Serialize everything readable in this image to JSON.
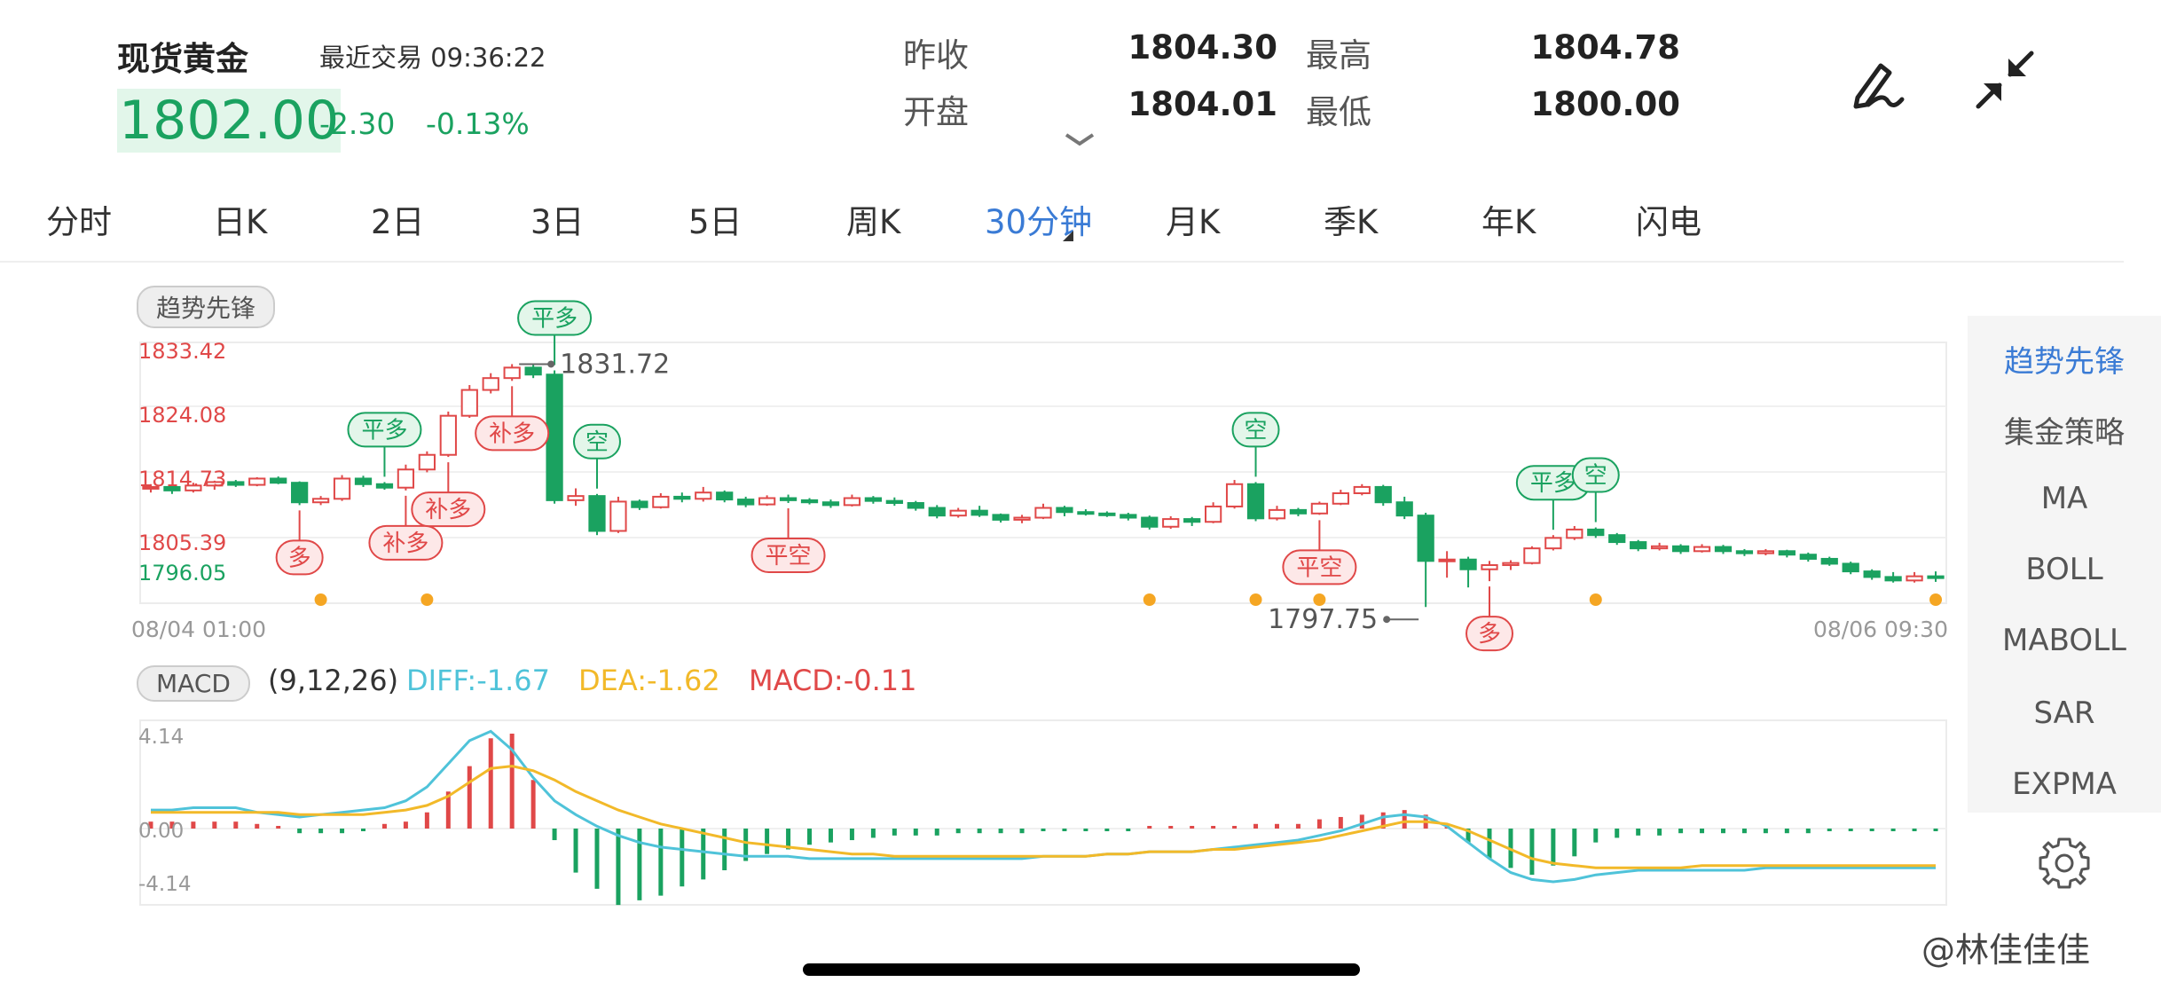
{
  "header": {
    "title": "现货黄金",
    "last_trade_label": "最近交易",
    "last_trade_time": "09:36:22",
    "price": "1802.00",
    "change": "-2.30",
    "change_pct": "-0.13%",
    "up_color": "#e04848",
    "down_color": "#1aa260"
  },
  "quote": {
    "prev_close_label": "昨收",
    "prev_close": "1804.30",
    "open_label": "开盘",
    "open": "1804.01",
    "high_label": "最高",
    "high": "1804.78",
    "low_label": "最低",
    "low": "1800.00"
  },
  "icons": {
    "collapse": "chevron-down-icon",
    "edit": "pen-icon",
    "shrink": "shrink-arrows-icon",
    "settings": "gear-icon"
  },
  "tabs": [
    {
      "label": "分时"
    },
    {
      "label": "日K"
    },
    {
      "label": "2日"
    },
    {
      "label": "3日"
    },
    {
      "label": "5日"
    },
    {
      "label": "周K"
    },
    {
      "label": "30分钟",
      "active": true
    },
    {
      "label": "月K"
    },
    {
      "label": "季K"
    },
    {
      "label": "年K"
    },
    {
      "label": "闪电"
    }
  ],
  "side_indicators": [
    {
      "label": "趋势先锋",
      "active": true
    },
    {
      "label": "集金策略"
    },
    {
      "label": "MA"
    },
    {
      "label": "BOLL"
    },
    {
      "label": "MABOLL"
    },
    {
      "label": "SAR"
    },
    {
      "label": "EXPMA"
    }
  ],
  "main_indicator": "趋势先锋",
  "sub_indicator": {
    "name": "MACD",
    "params": "(9,12,26)",
    "diff": "DIFF:-1.67",
    "dea": "DEA:-1.62",
    "macd": "MACD:-0.11",
    "diff_color": "#4fc3d9",
    "dea_color": "#f2b929",
    "macd_color": "#e04848"
  },
  "watermark": "@林佳佳佳",
  "chart_data": [
    {
      "type": "candlestick",
      "title": "",
      "y_ticks": [
        "1833.42",
        "1824.08",
        "1814.73",
        "1805.39",
        "1796.05"
      ],
      "x_ticks": [
        "08/04 01:00",
        "08/06 09:30"
      ],
      "ylim": [
        1796.05,
        1833.42
      ],
      "grid": true,
      "annotations": {
        "max_label": "1831.72",
        "min_label": "1797.75"
      },
      "signals": [
        {
          "index": 7,
          "label": "多",
          "kind": "buy"
        },
        {
          "index": 11,
          "label": "平多",
          "kind": "close"
        },
        {
          "index": 12,
          "label": "补多",
          "kind": "buy"
        },
        {
          "index": 14,
          "label": "补多",
          "kind": "buy"
        },
        {
          "index": 17,
          "label": "补多",
          "kind": "buy"
        },
        {
          "index": 19,
          "label": "平多",
          "kind": "close"
        },
        {
          "index": 21,
          "label": "空",
          "kind": "sell"
        },
        {
          "index": 30,
          "label": "平空",
          "kind": "close"
        },
        {
          "index": 52,
          "label": "空",
          "kind": "sell"
        },
        {
          "index": 55,
          "label": "平空",
          "kind": "close"
        },
        {
          "index": 63,
          "label": "多",
          "kind": "buy"
        },
        {
          "index": 66,
          "label": "平多",
          "kind": "close"
        },
        {
          "index": 68,
          "label": "空",
          "kind": "sell"
        }
      ],
      "dot_indices": [
        8,
        13,
        47,
        52,
        55,
        68,
        84,
        89
      ],
      "candles": [
        [
          1814.8,
          1815.4,
          1814.2,
          1815.0
        ],
        [
          1815.0,
          1815.2,
          1814.0,
          1814.5
        ],
        [
          1814.5,
          1815.6,
          1814.2,
          1815.2
        ],
        [
          1815.2,
          1815.9,
          1814.6,
          1815.7
        ],
        [
          1815.7,
          1816.0,
          1815.0,
          1815.3
        ],
        [
          1815.3,
          1816.4,
          1815.1,
          1816.2
        ],
        [
          1816.2,
          1816.5,
          1815.4,
          1815.6
        ],
        [
          1815.6,
          1815.8,
          1812.4,
          1812.8
        ],
        [
          1812.8,
          1813.7,
          1812.4,
          1813.3
        ],
        [
          1813.3,
          1816.7,
          1813.0,
          1816.2
        ],
        [
          1816.2,
          1816.6,
          1815.0,
          1815.4
        ],
        [
          1815.4,
          1815.7,
          1814.6,
          1814.9
        ],
        [
          1814.9,
          1818.2,
          1814.5,
          1817.5
        ],
        [
          1817.5,
          1820.1,
          1817.1,
          1819.6
        ],
        [
          1819.6,
          1825.8,
          1819.3,
          1825.2
        ],
        [
          1825.2,
          1829.6,
          1824.9,
          1828.9
        ],
        [
          1828.9,
          1831.3,
          1828.4,
          1830.6
        ],
        [
          1830.6,
          1832.6,
          1830.2,
          1832.1
        ],
        [
          1832.1,
          1832.5,
          1830.6,
          1831.1
        ],
        [
          1831.1,
          1831.7,
          1812.6,
          1813.1
        ],
        [
          1813.1,
          1814.8,
          1812.3,
          1813.7
        ],
        [
          1813.7,
          1814.0,
          1808.1,
          1808.7
        ],
        [
          1808.7,
          1813.6,
          1808.4,
          1812.9
        ],
        [
          1812.9,
          1813.2,
          1811.7,
          1812.1
        ],
        [
          1812.1,
          1814.1,
          1811.9,
          1813.6
        ],
        [
          1813.6,
          1814.2,
          1812.8,
          1813.3
        ],
        [
          1813.3,
          1815.0,
          1812.9,
          1814.2
        ],
        [
          1814.2,
          1814.5,
          1812.8,
          1813.2
        ],
        [
          1813.2,
          1813.6,
          1812.1,
          1812.5
        ],
        [
          1812.5,
          1813.8,
          1812.3,
          1813.4
        ],
        [
          1813.4,
          1813.9,
          1812.7,
          1813.1
        ],
        [
          1813.1,
          1813.4,
          1812.5,
          1812.8
        ],
        [
          1812.8,
          1813.2,
          1812.0,
          1812.4
        ],
        [
          1812.4,
          1813.9,
          1812.2,
          1813.4
        ],
        [
          1813.4,
          1813.7,
          1812.6,
          1813.0
        ],
        [
          1813.0,
          1813.5,
          1812.3,
          1812.7
        ],
        [
          1812.7,
          1813.0,
          1811.6,
          1812.0
        ],
        [
          1812.0,
          1812.4,
          1810.5,
          1810.9
        ],
        [
          1810.9,
          1812.0,
          1810.6,
          1811.6
        ],
        [
          1811.6,
          1812.3,
          1810.7,
          1811.0
        ],
        [
          1811.0,
          1811.2,
          1809.9,
          1810.3
        ],
        [
          1810.3,
          1811.0,
          1809.8,
          1810.6
        ],
        [
          1810.6,
          1812.6,
          1810.4,
          1812.0
        ],
        [
          1812.0,
          1812.3,
          1810.8,
          1811.4
        ],
        [
          1811.4,
          1811.8,
          1810.9,
          1811.2
        ],
        [
          1811.2,
          1811.5,
          1810.7,
          1811.0
        ],
        [
          1811.0,
          1811.3,
          1810.2,
          1810.6
        ],
        [
          1810.6,
          1810.9,
          1808.9,
          1809.3
        ],
        [
          1809.3,
          1810.8,
          1809.0,
          1810.4
        ],
        [
          1810.4,
          1810.7,
          1809.4,
          1810.0
        ],
        [
          1810.0,
          1812.8,
          1809.8,
          1812.2
        ],
        [
          1812.2,
          1816.0,
          1811.9,
          1815.4
        ],
        [
          1815.4,
          1815.7,
          1810.1,
          1810.5
        ],
        [
          1810.5,
          1812.3,
          1810.2,
          1811.7
        ],
        [
          1811.7,
          1812.0,
          1810.8,
          1811.2
        ],
        [
          1811.2,
          1812.9,
          1811.0,
          1812.6
        ],
        [
          1812.6,
          1814.6,
          1812.4,
          1814.1
        ],
        [
          1814.1,
          1815.4,
          1813.8,
          1815.0
        ],
        [
          1815.0,
          1815.3,
          1812.3,
          1812.8
        ],
        [
          1812.8,
          1813.6,
          1810.4,
          1810.9
        ],
        [
          1810.9,
          1811.3,
          1797.8,
          1804.4
        ],
        [
          1804.4,
          1805.8,
          1802.0,
          1804.6
        ],
        [
          1804.6,
          1805.0,
          1800.6,
          1803.2
        ],
        [
          1803.2,
          1804.4,
          1801.5,
          1803.8
        ],
        [
          1803.8,
          1804.5,
          1803.1,
          1804.1
        ],
        [
          1804.1,
          1806.5,
          1803.9,
          1806.2
        ],
        [
          1806.2,
          1808.1,
          1805.9,
          1807.7
        ],
        [
          1807.7,
          1809.4,
          1807.4,
          1808.9
        ],
        [
          1808.9,
          1809.2,
          1807.7,
          1808.1
        ],
        [
          1808.1,
          1808.4,
          1806.7,
          1807.1
        ],
        [
          1807.1,
          1807.4,
          1805.8,
          1806.2
        ],
        [
          1806.2,
          1807.0,
          1805.9,
          1806.5
        ],
        [
          1806.5,
          1806.8,
          1805.4,
          1805.8
        ],
        [
          1805.8,
          1806.8,
          1805.6,
          1806.4
        ],
        [
          1806.4,
          1806.7,
          1805.4,
          1805.8
        ],
        [
          1805.8,
          1806.1,
          1805.1,
          1805.5
        ],
        [
          1805.5,
          1806.1,
          1805.2,
          1805.8
        ],
        [
          1805.8,
          1806.0,
          1804.9,
          1805.3
        ],
        [
          1805.3,
          1805.6,
          1804.3,
          1804.7
        ],
        [
          1804.7,
          1805.0,
          1803.7,
          1804.0
        ],
        [
          1804.0,
          1804.3,
          1802.5,
          1802.9
        ],
        [
          1802.9,
          1803.2,
          1801.7,
          1802.1
        ],
        [
          1802.1,
          1802.8,
          1801.3,
          1801.6
        ],
        [
          1801.6,
          1802.8,
          1801.3,
          1802.2
        ],
        [
          1802.2,
          1802.9,
          1801.4,
          1802.0
        ]
      ]
    },
    {
      "type": "macd",
      "title": "MACD",
      "y_ticks": [
        "4.14",
        "0.00",
        "-4.14"
      ],
      "ylim": [
        -4.14,
        4.14
      ],
      "series": [
        {
          "name": "DIFF",
          "values": [
            0.8,
            0.8,
            0.9,
            0.9,
            0.9,
            0.7,
            0.6,
            0.5,
            0.6,
            0.7,
            0.8,
            0.9,
            1.2,
            1.8,
            2.8,
            3.8,
            4.2,
            3.4,
            2.2,
            1.2,
            0.6,
            0.1,
            -0.3,
            -0.6,
            -0.8,
            -0.9,
            -1.0,
            -1.1,
            -1.2,
            -1.2,
            -1.2,
            -1.3,
            -1.3,
            -1.3,
            -1.3,
            -1.3,
            -1.3,
            -1.3,
            -1.3,
            -1.3,
            -1.3,
            -1.3,
            -1.2,
            -1.2,
            -1.2,
            -1.1,
            -1.1,
            -1.0,
            -1.0,
            -1.0,
            -0.9,
            -0.8,
            -0.7,
            -0.6,
            -0.5,
            -0.3,
            -0.1,
            0.2,
            0.5,
            0.6,
            0.5,
            0.1,
            -0.6,
            -1.3,
            -1.9,
            -2.2,
            -2.3,
            -2.2,
            -2.0,
            -1.9,
            -1.8,
            -1.8,
            -1.8,
            -1.8,
            -1.8,
            -1.8,
            -1.7,
            -1.7,
            -1.7,
            -1.7,
            -1.7,
            -1.7,
            -1.7,
            -1.7,
            -1.7
          ]
        },
        {
          "name": "DEA",
          "values": [
            0.7,
            0.7,
            0.7,
            0.7,
            0.7,
            0.7,
            0.7,
            0.6,
            0.6,
            0.6,
            0.6,
            0.7,
            0.8,
            1.0,
            1.4,
            2.0,
            2.6,
            2.7,
            2.5,
            2.1,
            1.6,
            1.2,
            0.8,
            0.5,
            0.2,
            0.0,
            -0.2,
            -0.4,
            -0.6,
            -0.7,
            -0.8,
            -0.9,
            -1.0,
            -1.1,
            -1.1,
            -1.2,
            -1.2,
            -1.2,
            -1.2,
            -1.2,
            -1.2,
            -1.2,
            -1.2,
            -1.2,
            -1.2,
            -1.1,
            -1.1,
            -1.0,
            -1.0,
            -1.0,
            -0.9,
            -0.9,
            -0.8,
            -0.7,
            -0.6,
            -0.5,
            -0.3,
            -0.1,
            0.1,
            0.3,
            0.3,
            0.2,
            -0.1,
            -0.5,
            -0.9,
            -1.3,
            -1.5,
            -1.6,
            -1.7,
            -1.7,
            -1.7,
            -1.7,
            -1.7,
            -1.6,
            -1.6,
            -1.6,
            -1.6,
            -1.6,
            -1.6,
            -1.6,
            -1.6,
            -1.6,
            -1.6,
            -1.6,
            -1.6
          ]
        },
        {
          "name": "MACD",
          "values": [
            0.3,
            0.3,
            0.3,
            0.3,
            0.3,
            0.2,
            0.1,
            -0.2,
            -0.2,
            -0.2,
            -0.1,
            0.2,
            0.3,
            0.7,
            1.6,
            2.7,
            3.9,
            4.1,
            2.1,
            -0.5,
            -1.9,
            -2.6,
            -3.3,
            -3.1,
            -2.9,
            -2.5,
            -2.2,
            -1.8,
            -1.4,
            -1.1,
            -0.9,
            -0.7,
            -0.6,
            -0.5,
            -0.4,
            -0.3,
            -0.3,
            -0.3,
            -0.2,
            -0.2,
            -0.2,
            -0.2,
            -0.1,
            -0.1,
            -0.1,
            -0.1,
            -0.1,
            0.1,
            0.1,
            0.1,
            0.1,
            0.1,
            0.2,
            0.2,
            0.2,
            0.4,
            0.5,
            0.6,
            0.7,
            0.8,
            0.6,
            0.2,
            -0.6,
            -1.3,
            -1.7,
            -2.0,
            -1.6,
            -1.2,
            -0.6,
            -0.4,
            -0.3,
            -0.3,
            -0.2,
            -0.2,
            -0.2,
            -0.2,
            -0.2,
            -0.2,
            -0.2,
            -0.1,
            -0.1,
            -0.1,
            -0.1,
            -0.1,
            -0.1
          ]
        }
      ]
    }
  ]
}
